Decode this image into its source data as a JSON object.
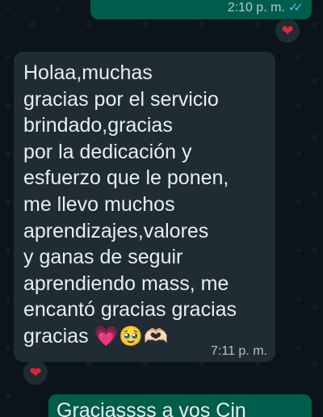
{
  "previous_outgoing": {
    "time": "2:10 p. m.",
    "read_ticks": "✓✓"
  },
  "reaction_top": {
    "emoji": "❤"
  },
  "incoming_message": {
    "text": "Holaa,muchas\ngracias por el servicio\nbrindado,gracias\npor la dedicación y\nesfuerzo que le ponen,\nme llevo muchos\naprendizajes,valores\ny ganas de seguir\naprendiendo mass, me\nencantó gracias gracias\ngracias",
    "emojis": "💗🥹🫶🏻",
    "time": "7:11 p. m."
  },
  "reaction_incoming": {
    "emoji": "❤"
  },
  "next_outgoing": {
    "text": "Graciassss a vos Cin"
  }
}
